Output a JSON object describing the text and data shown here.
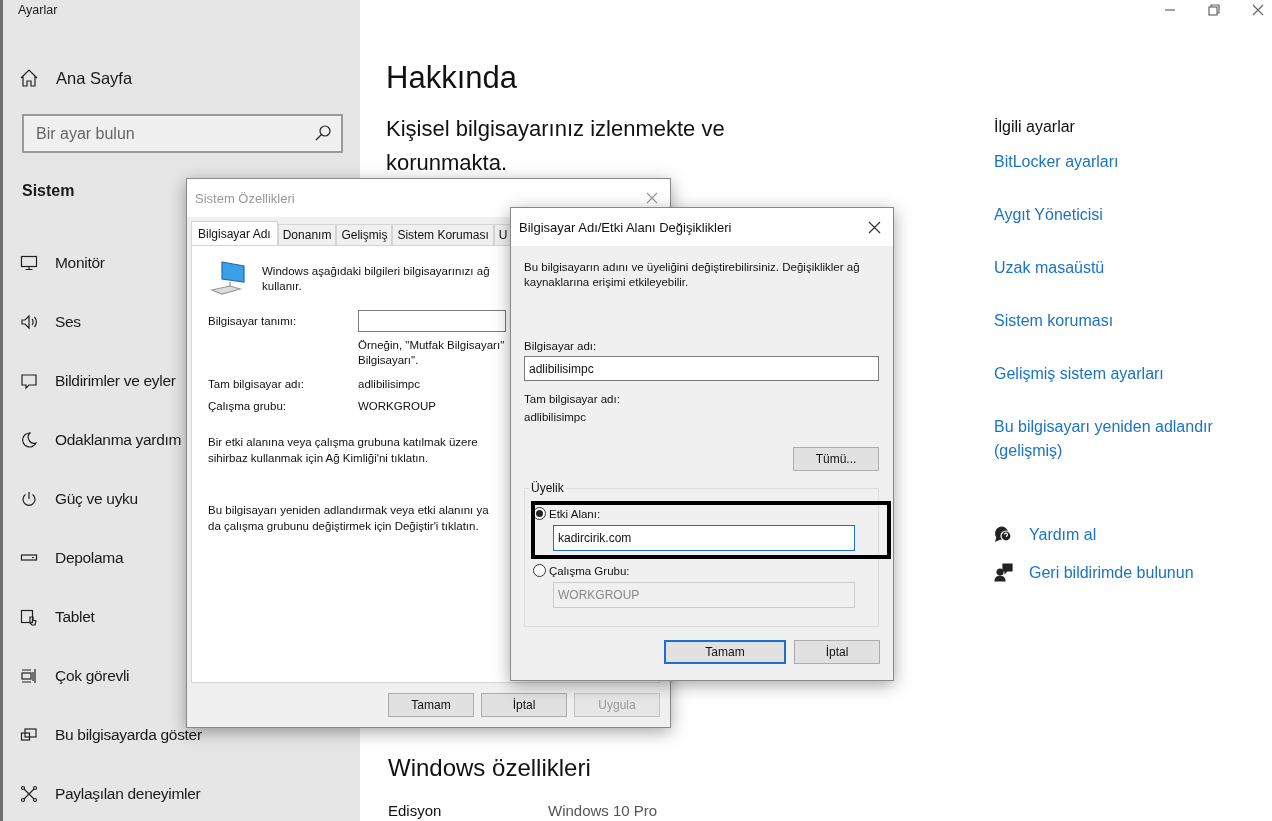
{
  "window": {
    "title": "Ayarlar"
  },
  "sidebar": {
    "home": "Ana Sayfa",
    "search": {
      "placeholder": "Bir ayar bulun"
    },
    "section": "Sistem",
    "items": [
      {
        "label": "Monitör",
        "selected": false
      },
      {
        "label": "Ses",
        "selected": false
      },
      {
        "label": "Bildirimler ve eyler",
        "selected": false
      },
      {
        "label": "Odaklanma yardım",
        "selected": false
      },
      {
        "label": "Güç ve uyku",
        "selected": false
      },
      {
        "label": "Depolama",
        "selected": false
      },
      {
        "label": "Tablet",
        "selected": false
      },
      {
        "label": "Çok görevli",
        "selected": false
      },
      {
        "label": "Bu bilgisayarda göster",
        "selected": false
      },
      {
        "label": "Paylaşılan deneyimler",
        "selected": false
      }
    ]
  },
  "about": {
    "title": "Hakkında",
    "status": "Kişisel bilgisayarınız izlenmekte ve korunmakta.",
    "section": "Windows özellikleri",
    "specs": [
      {
        "label": "Edisyon",
        "value": "Windows 10 Pro"
      }
    ]
  },
  "related": {
    "heading": "İlgili ayarlar",
    "links": [
      "BitLocker ayarları",
      "Aygıt Yöneticisi",
      "Uzak masaüstü",
      "Sistem koruması",
      "Gelişmiş sistem ayarları",
      "Bu bilgisayarı yeniden adlandır (gelişmiş)"
    ],
    "help": [
      "Yardım al",
      "Geri bildirimde bulunun"
    ]
  },
  "system_properties": {
    "title": "Sistem Özellikleri",
    "tabs": [
      {
        "label": "Bilgisayar Adı",
        "selected": true
      },
      {
        "label": "Donanım",
        "selected": false
      },
      {
        "label": "Gelişmiş",
        "selected": false
      },
      {
        "label": "Sistem Koruması",
        "selected": false
      },
      {
        "label": "U",
        "selected": false
      }
    ],
    "intro_lines": [
      "Windows aşağıdaki bilgileri bilgisayarınızı ağ",
      "kullanır."
    ],
    "description_label": "Bilgisayar tanımı:",
    "example_lines": [
      "Örneğin, \"Mutfak Bilgisayarı\"",
      "Bilgisayarı\"."
    ],
    "full_name_label": "Tam bilgisayar adı:",
    "full_name": "adlibilisimpc",
    "workgroup_label": "Çalışma grubu:",
    "workgroup": "WORKGROUP",
    "paragraphs": [
      "Bir etki alanına veya çalışma grubuna katılmak üzere sihirbaz kullanmak için Ağ Kimliği'ni tıklatın.",
      "Bu bilgisayarı yeniden adlandırmak veya etki alanını ya da çalışma grubunu değiştirmek için Değiştir'i tıklatın."
    ],
    "buttons": [
      {
        "label": "Tamam",
        "disabled": false
      },
      {
        "label": "İptal",
        "disabled": false
      },
      {
        "label": "Uygula",
        "disabled": true
      }
    ]
  },
  "name_dialog": {
    "title": "Bilgisayar Adı/Etki Alanı Değişiklikleri",
    "intro": "Bu bilgisayarın adını ve üyeliğini değiştirebilirsiniz. Değişiklikler ağ kaynaklarına erişimi etkileyebilir.",
    "name_label": "Bilgisayar adı:",
    "name": "adlibilisimpc",
    "full_name_label": "Tam bilgisayar adı:",
    "full_name": "adlibilisimpc",
    "more_button": "Tümü...",
    "membership": {
      "label": "Üyelik",
      "options": [
        {
          "label": "Etki Alanı:",
          "selected": true,
          "value": "kadircirik.com",
          "disabled": false,
          "highlighted": true
        },
        {
          "label": "Çalışma Grubu:",
          "selected": false,
          "value": "WORKGROUP",
          "disabled": true,
          "highlighted": false
        }
      ]
    },
    "buttons": [
      {
        "label": "Tamam",
        "default": true
      },
      {
        "label": "İptal",
        "default": false
      }
    ]
  }
}
